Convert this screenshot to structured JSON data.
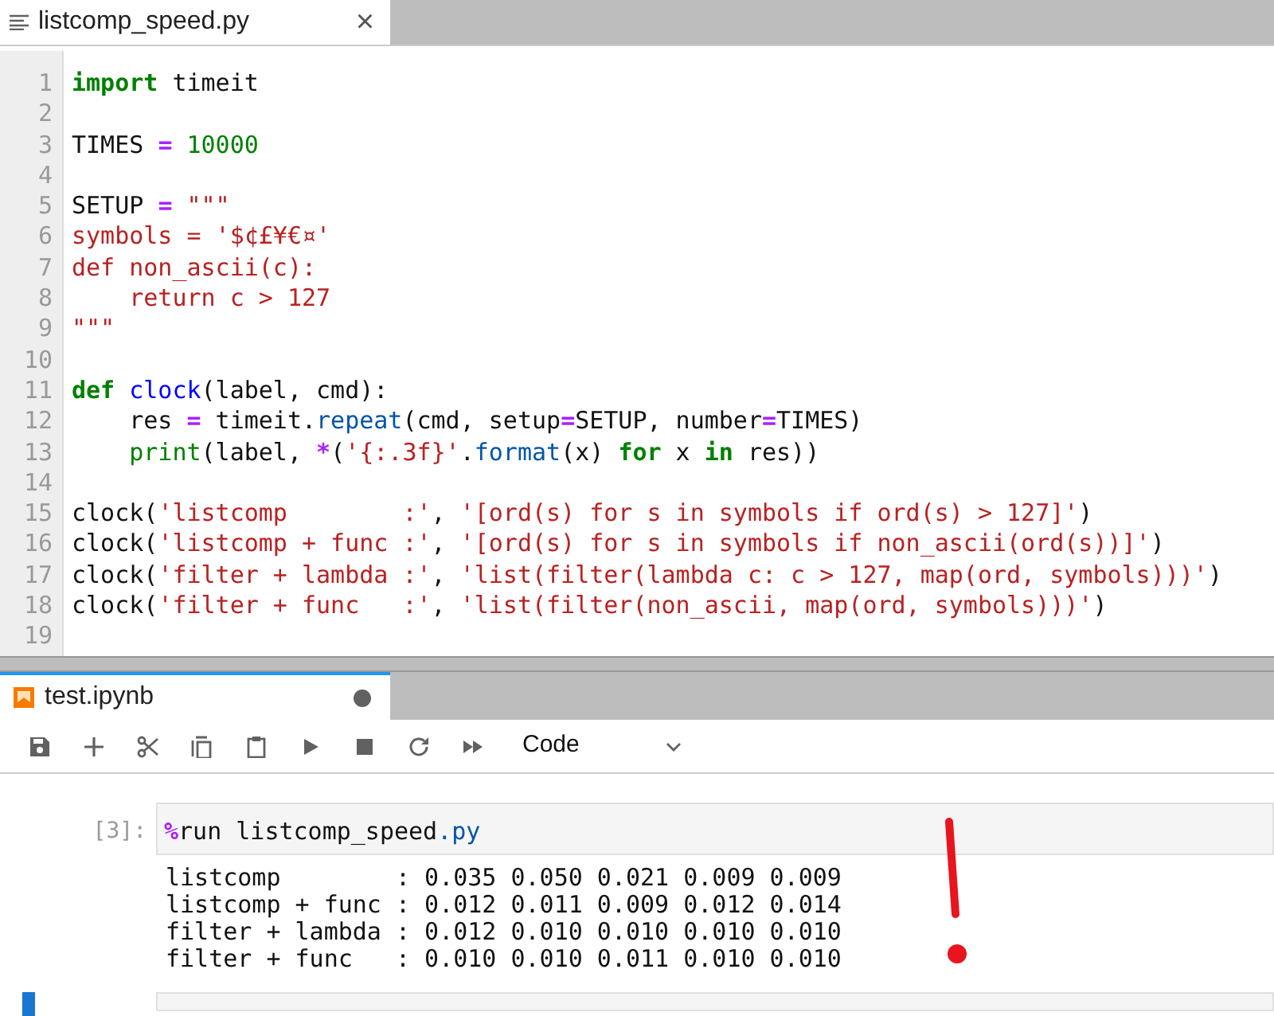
{
  "editor_tab": {
    "title": "listcomp_speed.py",
    "close": "×"
  },
  "code_lines": [
    {
      "number": "1",
      "tokens": [
        {
          "kind": "k",
          "text": "import"
        },
        {
          "kind": "n",
          "text": " timeit"
        }
      ]
    },
    {
      "number": "2"
    },
    {
      "number": "3",
      "tokens": [
        {
          "kind": "n",
          "text": "TIMES "
        },
        {
          "kind": "o",
          "text": "="
        },
        {
          "kind": "m",
          "text": " 10000"
        }
      ]
    },
    {
      "number": "4"
    },
    {
      "number": "5",
      "tokens": [
        {
          "kind": "n",
          "text": "SETUP "
        },
        {
          "kind": "o",
          "text": "="
        },
        {
          "kind": "s",
          "text": " \"\"\""
        }
      ]
    },
    {
      "number": "6",
      "tokens": [
        {
          "kind": "s",
          "text": "symbols = '$¢£¥€¤'"
        }
      ]
    },
    {
      "number": "7",
      "tokens": [
        {
          "kind": "s",
          "text": "def non_ascii(c):"
        }
      ]
    },
    {
      "number": "8",
      "tokens": [
        {
          "kind": "s",
          "text": "    return c > 127"
        }
      ]
    },
    {
      "number": "9",
      "tokens": [
        {
          "kind": "s",
          "text": "\"\"\""
        }
      ]
    },
    {
      "number": "10"
    },
    {
      "number": "11",
      "tokens": [
        {
          "kind": "k",
          "text": "def"
        },
        {
          "kind": "f",
          "text": " clock"
        },
        {
          "kind": "n",
          "text": "(label, cmd):"
        }
      ]
    },
    {
      "number": "12",
      "tokens": [
        {
          "kind": "n",
          "text": "    res "
        },
        {
          "kind": "o",
          "text": "="
        },
        {
          "kind": "n",
          "text": " timeit."
        },
        {
          "kind": "p",
          "text": "repeat"
        },
        {
          "kind": "n",
          "text": "(cmd, setup"
        },
        {
          "kind": "o",
          "text": "="
        },
        {
          "kind": "n",
          "text": "SETUP, number"
        },
        {
          "kind": "o",
          "text": "="
        },
        {
          "kind": "n",
          "text": "TIMES)"
        }
      ]
    },
    {
      "number": "13",
      "tokens": [
        {
          "kind": "b",
          "text": "    print"
        },
        {
          "kind": "n",
          "text": "(label, "
        },
        {
          "kind": "o",
          "text": "*"
        },
        {
          "kind": "n",
          "text": "("
        },
        {
          "kind": "s",
          "text": "'{:.3f}'"
        },
        {
          "kind": "n",
          "text": "."
        },
        {
          "kind": "p",
          "text": "format"
        },
        {
          "kind": "n",
          "text": "(x) "
        },
        {
          "kind": "k",
          "text": "for"
        },
        {
          "kind": "n",
          "text": " x "
        },
        {
          "kind": "k",
          "text": "in"
        },
        {
          "kind": "n",
          "text": " res))"
        }
      ]
    },
    {
      "number": "14"
    },
    {
      "number": "15",
      "tokens": [
        {
          "kind": "n",
          "text": "clock("
        },
        {
          "kind": "s",
          "text": "'listcomp        :'"
        },
        {
          "kind": "n",
          "text": ", "
        },
        {
          "kind": "s",
          "text": "'[ord(s) for s in symbols if ord(s) > 127]'"
        },
        {
          "kind": "n",
          "text": ")"
        }
      ]
    },
    {
      "number": "16",
      "tokens": [
        {
          "kind": "n",
          "text": "clock("
        },
        {
          "kind": "s",
          "text": "'listcomp + func :'"
        },
        {
          "kind": "n",
          "text": ", "
        },
        {
          "kind": "s",
          "text": "'[ord(s) for s in symbols if non_ascii(ord(s))]'"
        },
        {
          "kind": "n",
          "text": ")"
        }
      ]
    },
    {
      "number": "17",
      "tokens": [
        {
          "kind": "n",
          "text": "clock("
        },
        {
          "kind": "s",
          "text": "'filter + lambda :'"
        },
        {
          "kind": "n",
          "text": ", "
        },
        {
          "kind": "s",
          "text": "'list(filter(lambda c: c > 127, map(ord, symbols)))'"
        },
        {
          "kind": "n",
          "text": ")"
        }
      ]
    },
    {
      "number": "18",
      "tokens": [
        {
          "kind": "n",
          "text": "clock("
        },
        {
          "kind": "s",
          "text": "'filter + func   :'"
        },
        {
          "kind": "n",
          "text": ", "
        },
        {
          "kind": "s",
          "text": "'list(filter(non_ascii, map(ord, symbols)))'"
        },
        {
          "kind": "n",
          "text": ")"
        }
      ]
    },
    {
      "number": "19"
    }
  ],
  "notebook_tab": {
    "title": "test.ipynb",
    "unsaved": true
  },
  "toolbar": {
    "buttons": [
      {
        "kind": "save"
      },
      {
        "kind": "add"
      },
      {
        "kind": "cut"
      },
      {
        "kind": "copy"
      },
      {
        "kind": "paste"
      },
      {
        "kind": "run"
      },
      {
        "kind": "stop"
      },
      {
        "kind": "restart"
      },
      {
        "kind": "run-all"
      }
    ],
    "cell_type": "Code"
  },
  "cells": [
    {
      "prompt": "[3]:",
      "input_tokens": [
        {
          "kind": "o",
          "text": "%"
        },
        {
          "kind": "n",
          "text": "run listcomp_speed"
        },
        {
          "kind": "p",
          "text": ".py"
        }
      ],
      "output": [
        "listcomp        : 0.035 0.050 0.021 0.009 0.009",
        "listcomp + func : 0.012 0.011 0.009 0.012 0.014",
        "filter + lambda : 0.012 0.010 0.010 0.010 0.010",
        "filter + func   : 0.010 0.010 0.011 0.010 0.010"
      ]
    },
    {
      "active": true
    }
  ]
}
